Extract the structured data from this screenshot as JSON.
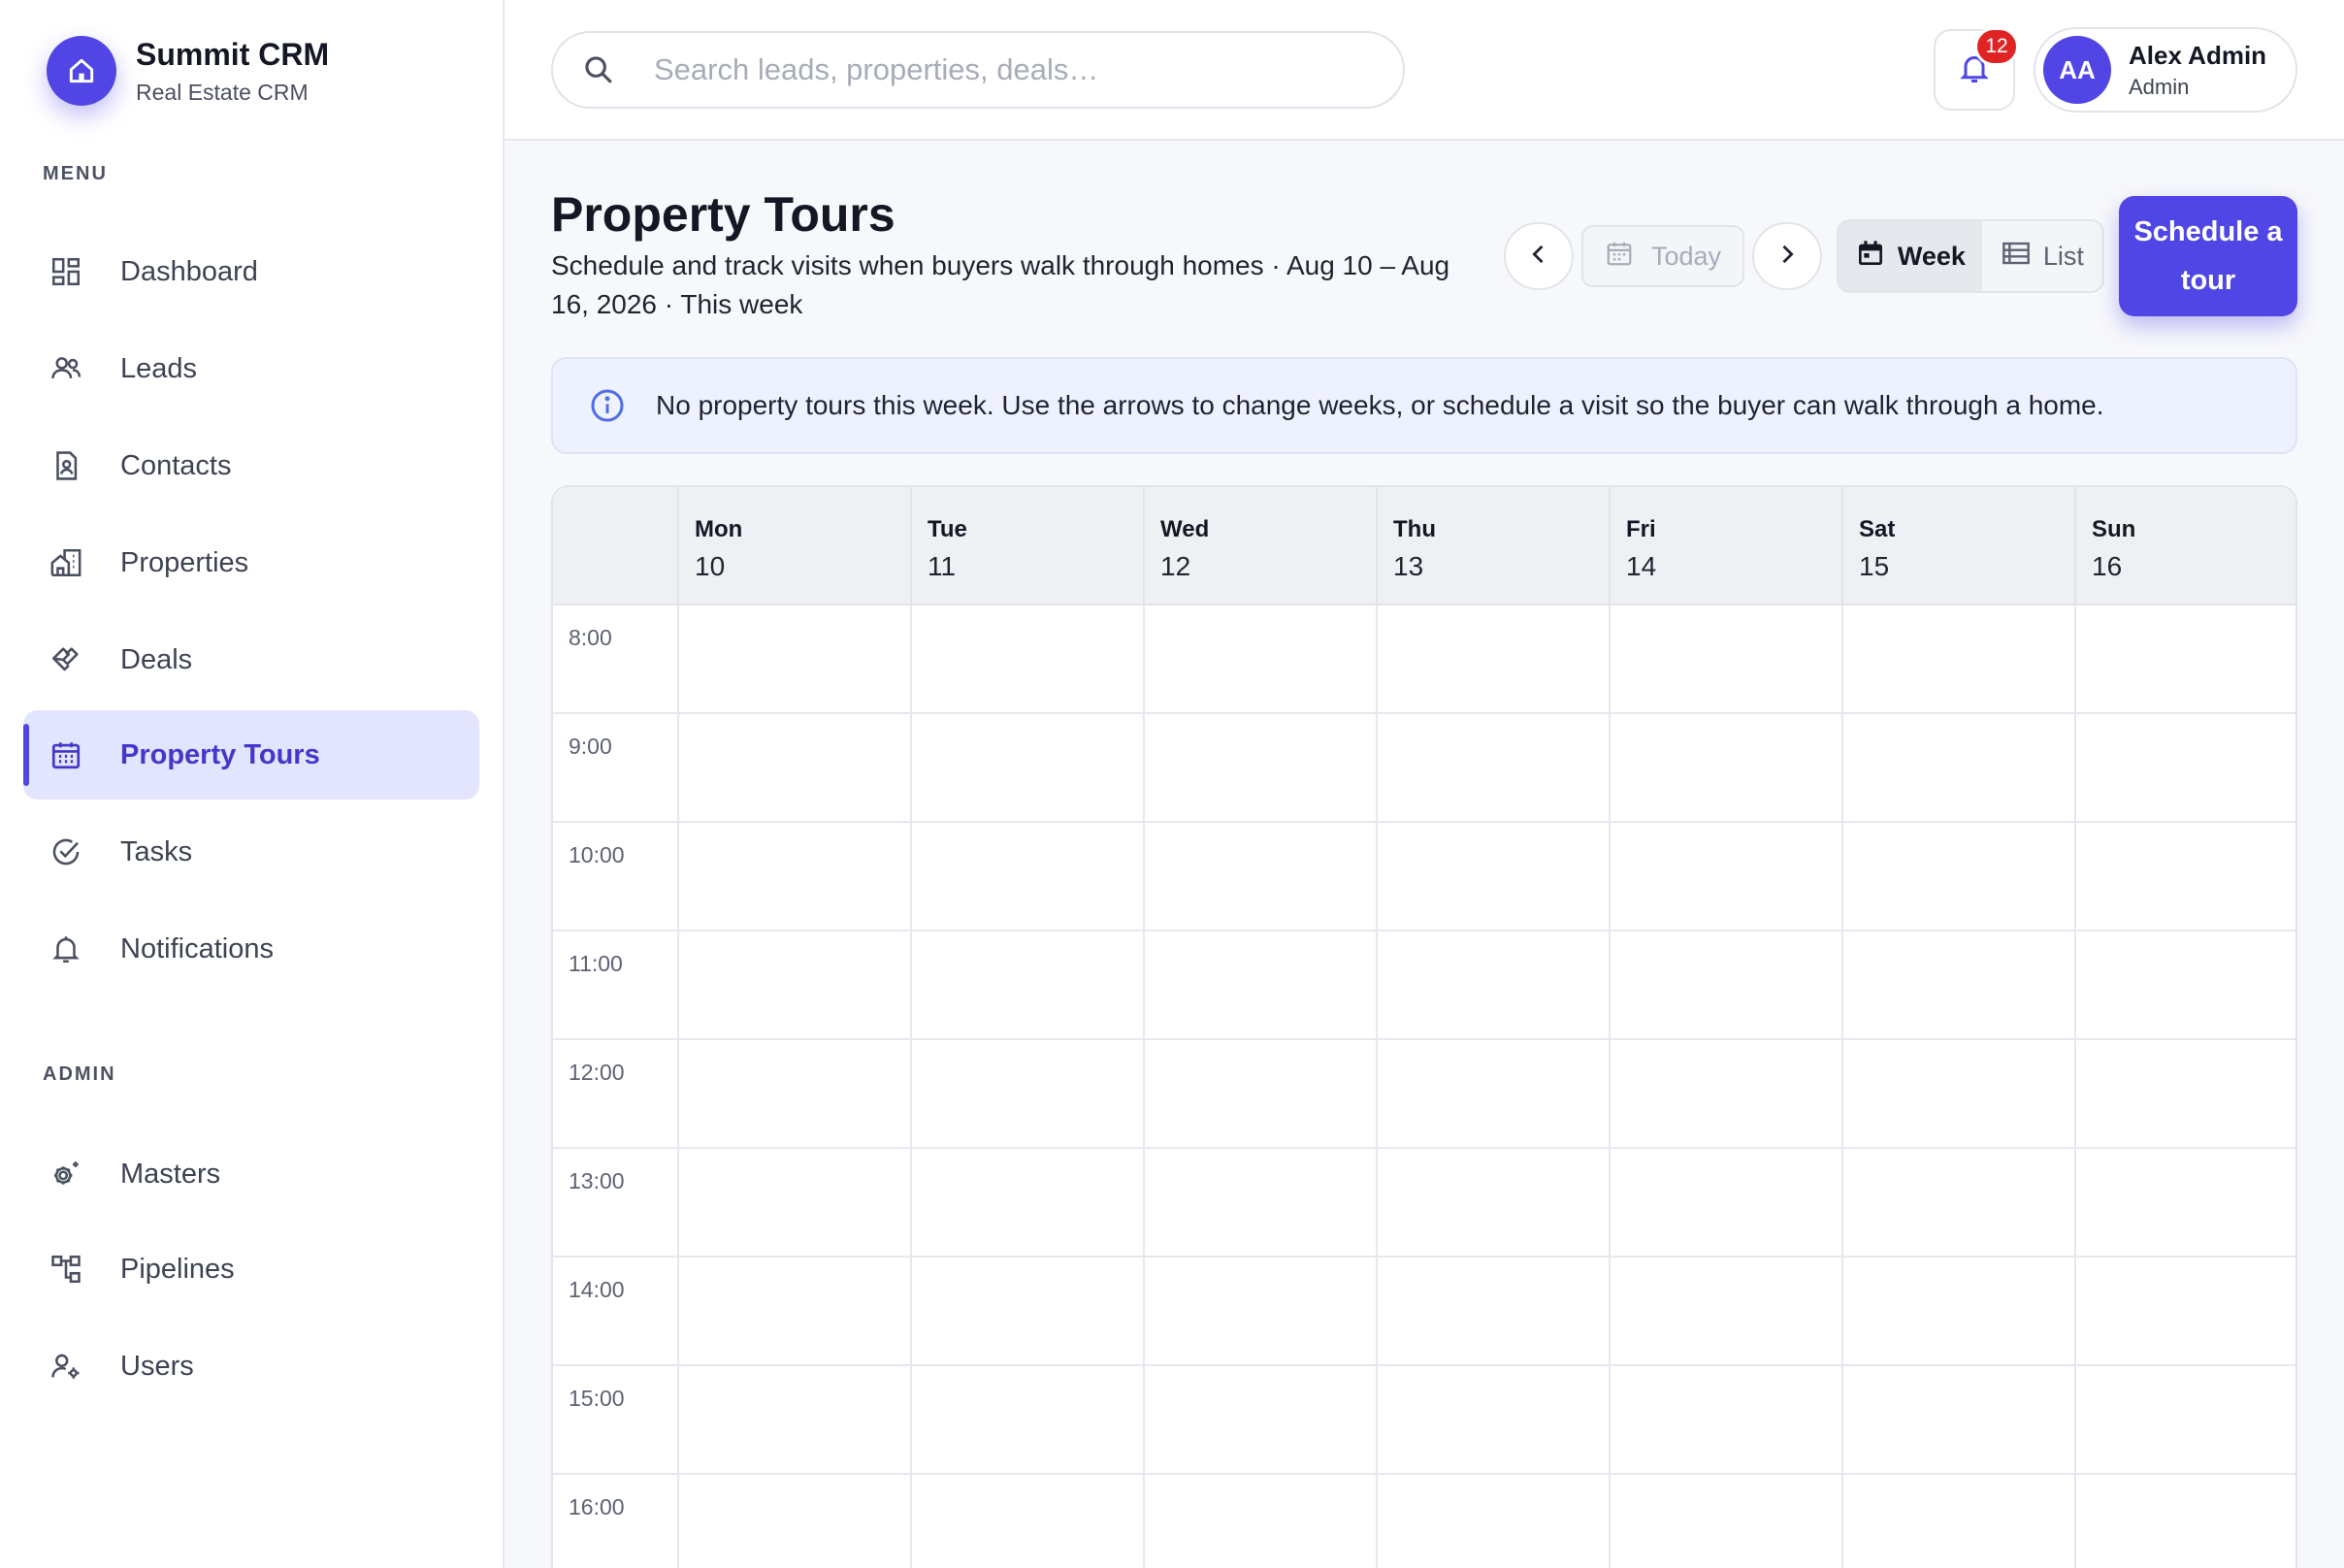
{
  "brand": {
    "name": "Summit CRM",
    "subtitle": "Real Estate CRM"
  },
  "sidebar": {
    "menu_label": "MENU",
    "admin_label": "ADMIN",
    "menu_items": [
      {
        "label": "Dashboard",
        "icon": "dashboard-icon"
      },
      {
        "label": "Leads",
        "icon": "users-icon"
      },
      {
        "label": "Contacts",
        "icon": "contact-card-icon"
      },
      {
        "label": "Properties",
        "icon": "buildings-icon"
      },
      {
        "label": "Deals",
        "icon": "handshake-icon"
      },
      {
        "label": "Property Tours",
        "icon": "calendar-icon",
        "active": true
      },
      {
        "label": "Tasks",
        "icon": "check-circle-icon"
      },
      {
        "label": "Notifications",
        "icon": "bell-icon"
      }
    ],
    "admin_items": [
      {
        "label": "Masters",
        "icon": "gear-sparkle-icon"
      },
      {
        "label": "Pipelines",
        "icon": "pipeline-icon"
      },
      {
        "label": "Users",
        "icon": "user-settings-icon"
      }
    ]
  },
  "search": {
    "placeholder": "Search leads, properties, deals…",
    "value": ""
  },
  "notifications": {
    "count": "12"
  },
  "user": {
    "initials": "AA",
    "name": "Alex Admin",
    "role": "Admin"
  },
  "page": {
    "title": "Property Tours",
    "subtitle": "Schedule and track visits when buyers walk through homes · Aug 10 – Aug 16, 2026 · This week"
  },
  "toolbar": {
    "today_label": "Today",
    "week_label": "Week",
    "list_label": "List",
    "primary_label": "Schedule a tour"
  },
  "banner": {
    "message": "No property tours this week. Use the arrows to change weeks, or schedule a visit so the buyer can walk through a home."
  },
  "calendar": {
    "days": [
      {
        "name": "Mon",
        "num": "10"
      },
      {
        "name": "Tue",
        "num": "11"
      },
      {
        "name": "Wed",
        "num": "12"
      },
      {
        "name": "Thu",
        "num": "13"
      },
      {
        "name": "Fri",
        "num": "14"
      },
      {
        "name": "Sat",
        "num": "15"
      },
      {
        "name": "Sun",
        "num": "16"
      }
    ],
    "hours": [
      "8:00",
      "9:00",
      "10:00",
      "11:00",
      "12:00",
      "13:00",
      "14:00",
      "15:00",
      "16:00"
    ]
  },
  "colors": {
    "accent": "#4f46e5",
    "badge": "#e02424",
    "active_bg": "#e2e5fd"
  }
}
